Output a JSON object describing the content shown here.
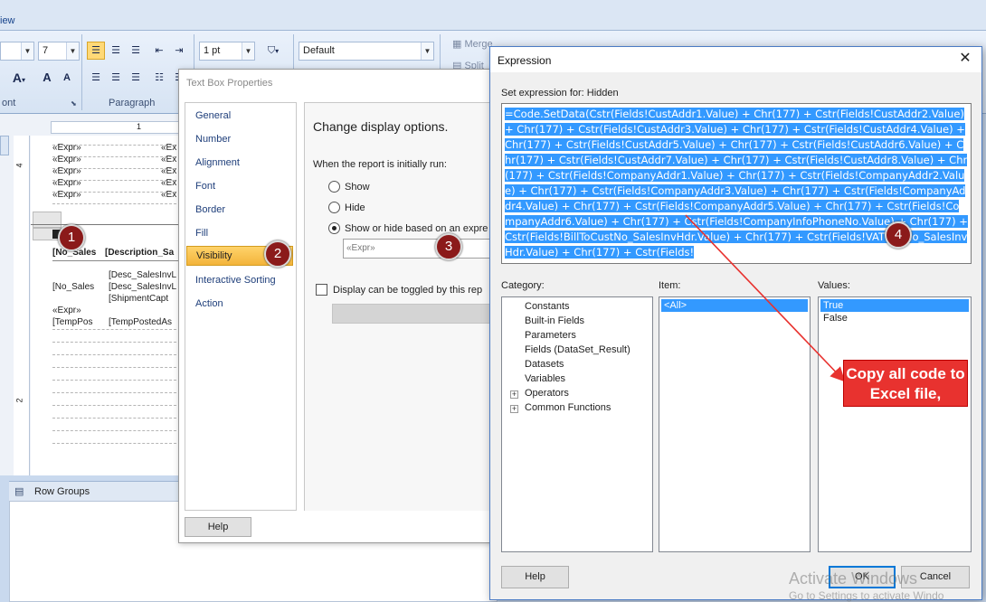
{
  "ribbon": {
    "tab_partial": "iew",
    "font_size": "7",
    "line_width": "1 pt",
    "style_combo": "Default",
    "merge_label": "Merge",
    "split_label": "Split",
    "group_font": "ont",
    "group_paragraph": "Paragraph"
  },
  "designer": {
    "ruler_mark": "1",
    "ruler_left_4": "4",
    "ruler_left_2": "2",
    "cells": [
      "«Expr»",
      "«Expr»",
      "«Expr»",
      "«Expr»",
      "«Expr»",
      "«Ex",
      "«Ex",
      "«Ex",
      "«Ex",
      "«Ex",
      "[No_Sales",
      "[Description_Sa",
      "[Desc_SalesInvL",
      "[No_Sales",
      "[Desc_SalesInvL",
      "[ShipmentCapt",
      "«Expr»",
      "[TempPos",
      "[TempPostedAs"
    ],
    "row_groups_label": "Row Groups"
  },
  "textbox_properties": {
    "title": "Text Box Properties",
    "nav": [
      "General",
      "Number",
      "Alignment",
      "Font",
      "Border",
      "Fill",
      "Visibility",
      "Interactive Sorting",
      "Action"
    ],
    "selected_nav": "Visibility",
    "heading": "Change display options.",
    "initially_label": "When the report is initially run:",
    "options": [
      "Show",
      "Hide",
      "Show or hide based on an expre"
    ],
    "selected_option": "Show or hide based on an expre",
    "expr_placeholder": "«Expr»",
    "toggle_label": "Display can be toggled by this rep",
    "help_label": "Help"
  },
  "expression_dialog": {
    "title": "Expression",
    "close_glyph": "✕",
    "set_expression_label": "Set expression for: Hidden",
    "expression_text": "=Code.SetData(Cstr(Fields!CustAddr1.Value) + Chr(177) + Cstr(Fields!CustAddr2.Value) + Chr(177) + Cstr(Fields!CustAddr3.Value) + Chr(177) + Cstr(Fields!CustAddr4.Value) + Chr(177) + Cstr(Fields!CustAddr5.Value) + Chr(177) + Cstr(Fields!CustAddr6.Value) + Chr(177) + Cstr(Fields!CustAddr7.Value) + Chr(177) + Cstr(Fields!CustAddr8.Value) + Chr(177) + Cstr(Fields!CompanyAddr1.Value) + Chr(177) + Cstr(Fields!CompanyAddr2.Value) + Chr(177) + Cstr(Fields!CompanyAddr3.Value) + Chr(177) + Cstr(Fields!CompanyAddr4.Value) + Chr(177) + Cstr(Fields!CompanyAddr5.Value) + Chr(177) + Cstr(Fields!CompanyAddr6.Value) + Chr(177) + Cstr(Fields!CompanyInfoPhoneNo.Value) + Chr(177) + Cstr(Fields!BillToCustNo_SalesInvHdr.Value) + Chr(177) + Cstr(Fields!VATRegNo_SalesInvHdr.Value) + Chr(177) + Cstr(Fields!",
    "category_label": "Category:",
    "item_label": "Item:",
    "values_label": "Values:",
    "categories": [
      "Constants",
      "Built-in Fields",
      "Parameters",
      "Fields (DataSet_Result)",
      "Datasets",
      "Variables",
      "Operators",
      "Common Functions"
    ],
    "items": [
      "<All>"
    ],
    "values": [
      "True",
      "False"
    ],
    "help_label": "Help",
    "ok_label": "OK",
    "cancel_label": "Cancel"
  },
  "annotations": {
    "badges": [
      "1",
      "2",
      "3",
      "4"
    ],
    "callout": "Copy all code to Excel file,",
    "badge_color": "#8b1a1a",
    "callout_color": "#e8322f"
  },
  "watermark": {
    "line1": "Activate Windows",
    "line2": "Go to Settings to activate Windo"
  }
}
